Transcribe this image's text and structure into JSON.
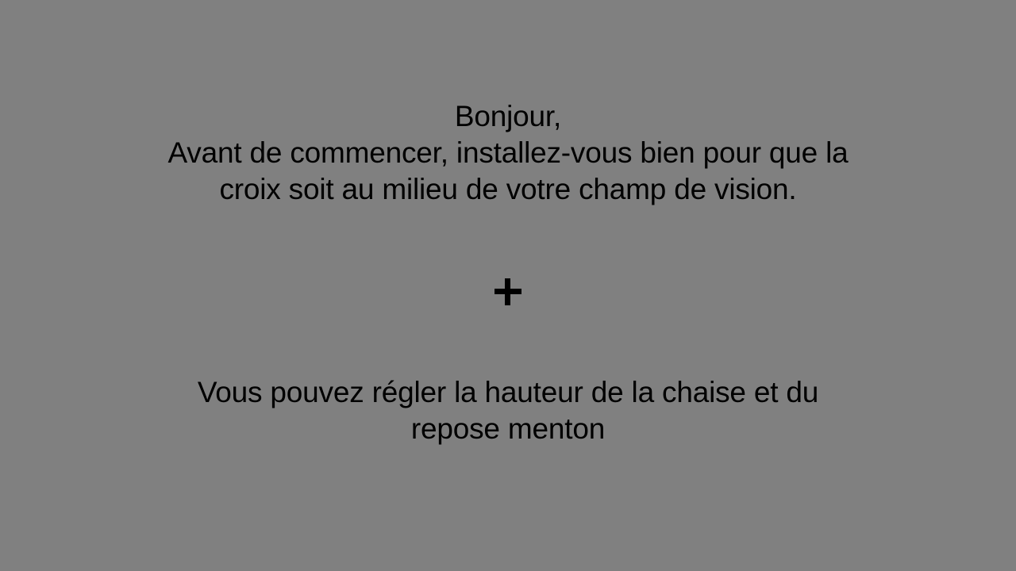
{
  "instructions": {
    "greeting": "Bonjour,",
    "line1": "Avant de commencer, installez-vous bien pour que la",
    "line2": "croix soit au milieu de votre champ de vision.",
    "adjust_line1": "Vous pouvez régler la hauteur de la chaise et du",
    "adjust_line2": "repose menton"
  },
  "fixation": {
    "icon": "plus-icon",
    "color": "#000000"
  },
  "colors": {
    "background": "#808080",
    "text": "#000000"
  }
}
